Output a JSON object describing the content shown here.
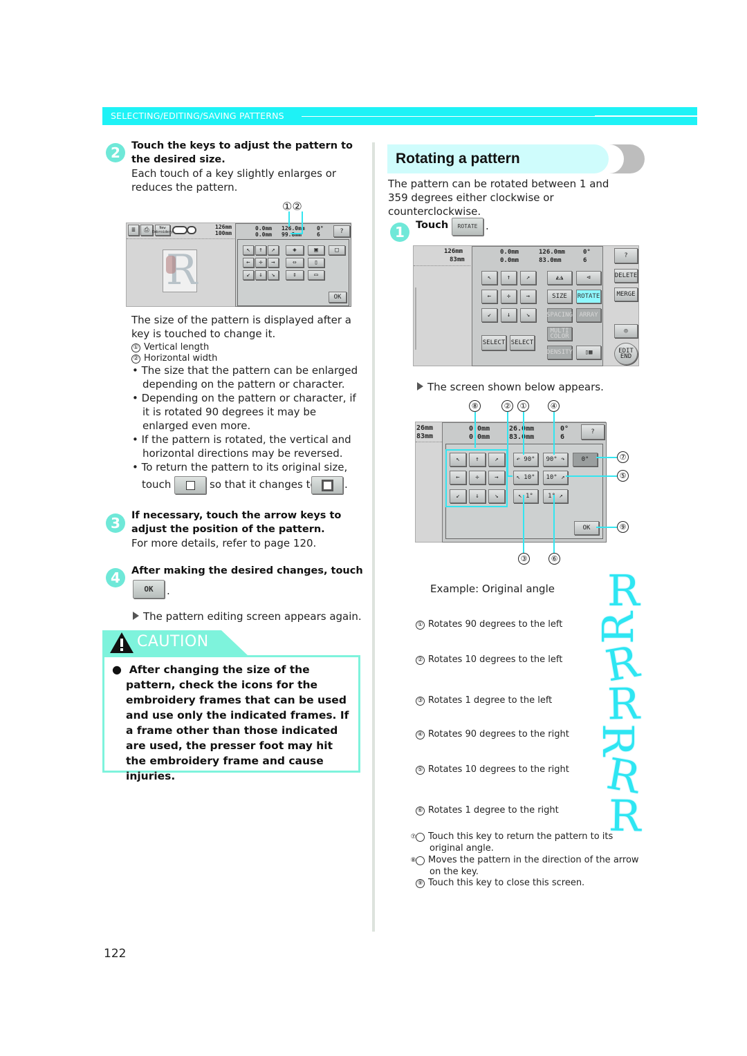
{
  "header": {
    "section": "SELECTING/EDITING/SAVING PATTERNS"
  },
  "left": {
    "step2": {
      "num": "2",
      "heading": "Touch the keys to adjust the pattern to the desired size.",
      "body": "Each touch of a key slightly enlarges or reduces the pattern.",
      "callouts": "①②",
      "screen": {
        "size_v": "126mm",
        "size_h": "100mm",
        "pos_v": "0.0mm",
        "pos_h": "0.0mm",
        "len_v": "126.0mm",
        "len_h": "99.8mm",
        "angle": "0°",
        "colors": "6",
        "ok": "OK",
        "new_embroidery": "New Embroidery"
      },
      "after": "The size of the pattern is displayed after a key is touched to change it.",
      "legend": [
        {
          "n": "①",
          "text": "Vertical length"
        },
        {
          "n": "②",
          "text": "Horizontal width"
        }
      ],
      "bullets": [
        "The size that the pattern can be enlarged depending on the pattern or character.",
        "Depending on the pattern or character, if it is rotated 90 degrees it may be enlarged even more.",
        "If the pattern is rotated, the vertical and horizontal directions may be reversed.",
        "To return the pattern to its original size,"
      ],
      "touch_word": "touch",
      "changes_to": "so that it changes to",
      "period": "."
    },
    "step3": {
      "num": "3",
      "heading": "If necessary, touch the arrow keys to adjust the position of the pattern.",
      "body": "For more details, refer to page 120."
    },
    "step4": {
      "num": "4",
      "heading": "After making the desired changes, touch",
      "key": "OK",
      "period": ".",
      "result": "The pattern editing screen appears again."
    },
    "caution": {
      "label": "CAUTION",
      "text": "After changing the size of the pattern, check the icons for the embroidery frames that can be used and use only the indicated frames. If a frame other than those indicated are used, the presser foot may hit the embroidery frame and cause injuries."
    }
  },
  "right": {
    "title": "Rotating a pattern",
    "intro": "The pattern can be rotated between 1 and 359 degrees either clockwise or counterclockwise.",
    "step1": {
      "num": "1",
      "touch": "Touch",
      "key": "ROTATE",
      "period": "."
    },
    "screen1": {
      "size_v": "126mm",
      "size_h": "83mm",
      "pos_v": "0.0mm",
      "pos_h": "0.0mm",
      "len_v": "126.0mm",
      "len_h": "83.0mm",
      "angle": "0°",
      "colors": "6",
      "buttons": {
        "size": "SIZE",
        "rotate": "ROTATE",
        "spacing": "SPACING",
        "array": "ARRAY",
        "multi_color": "MULTI COLOR",
        "density": "DENSITY",
        "select_prev": "SELECT",
        "select_next": "SELECT",
        "delete": "DELETE",
        "merge": "MERGE",
        "edit_end": "EDIT END"
      }
    },
    "result": "The screen shown below appears.",
    "screen2": {
      "size_v": "26mm",
      "size_h": "83mm",
      "pos_v": "0.0mm",
      "pos_h": "0.0mm",
      "len_v": "26.0mm",
      "len_h": "83.0mm",
      "angle": "0°",
      "colors": "6",
      "buttons": {
        "left90": "90°",
        "right90": "90°",
        "reset": "0°",
        "left10": "10°",
        "right10": "10°",
        "left1": "1°",
        "right1": "1°",
        "ok": "OK"
      },
      "callouts": [
        "⑧",
        "②",
        "①",
        "④",
        "⑦",
        "⑤",
        "⑨",
        "③",
        "⑥"
      ]
    },
    "example_label": "Example: Original angle",
    "legend": [
      {
        "n": "①",
        "text": "Rotates 90 degrees to the left"
      },
      {
        "n": "②",
        "text": "Rotates 10 degrees to the left"
      },
      {
        "n": "③",
        "text": "Rotates 1 degree to the left"
      },
      {
        "n": "④",
        "text": "Rotates 90 degrees to the right"
      },
      {
        "n": "⑤",
        "text": "Rotates 10 degrees to the right"
      },
      {
        "n": "⑥",
        "text": "Rotates 1 degree to the right"
      },
      {
        "n": "⑦",
        "text": "Touch this key to return the pattern to its original angle."
      },
      {
        "n": "⑧",
        "text": "Moves the pattern in the direction of the arrow on the key."
      },
      {
        "n": "⑨",
        "text": "Touch this key to close this screen."
      }
    ],
    "example_letter": "R"
  },
  "footer": {
    "page_number": "122"
  },
  "colors": {
    "accent": "#1ef2f6",
    "caution": "#7ef3dc",
    "step_badge": "#6fe8d8"
  }
}
